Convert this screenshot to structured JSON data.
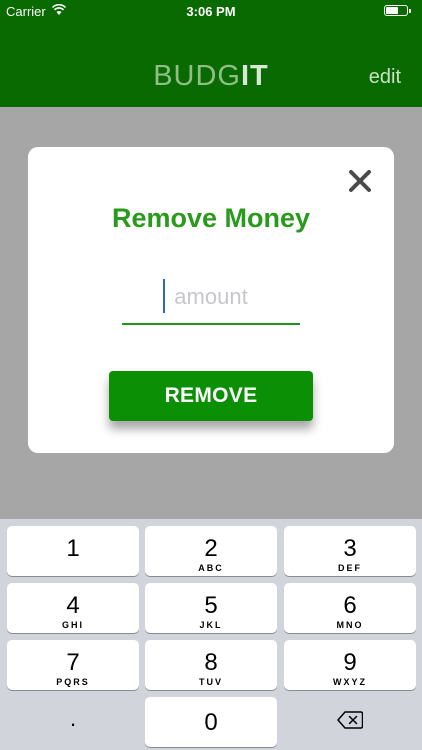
{
  "status": {
    "carrier": "Carrier",
    "time": "3:06 PM"
  },
  "nav": {
    "brand_light": "BUDG",
    "brand_bold": "IT",
    "edit_label": "edit"
  },
  "modal": {
    "title": "Remove Money",
    "amount_placeholder": "amount",
    "amount_value": "",
    "button_label": "REMOVE"
  },
  "keyboard": {
    "keys": [
      {
        "digit": "1",
        "letters": ""
      },
      {
        "digit": "2",
        "letters": "ABC"
      },
      {
        "digit": "3",
        "letters": "DEF"
      },
      {
        "digit": "4",
        "letters": "GHI"
      },
      {
        "digit": "5",
        "letters": "JKL"
      },
      {
        "digit": "6",
        "letters": "MNO"
      },
      {
        "digit": "7",
        "letters": "PQRS"
      },
      {
        "digit": "8",
        "letters": "TUV"
      },
      {
        "digit": "9",
        "letters": "WXYZ"
      },
      {
        "digit": "0",
        "letters": ""
      }
    ],
    "decimal_label": ".",
    "delete_icon": "backspace-icon"
  },
  "colors": {
    "nav_bg": "#086a00",
    "accent": "#2a9a1d",
    "button_bg": "#0b8f05",
    "overlay": "#a6a6a6"
  }
}
